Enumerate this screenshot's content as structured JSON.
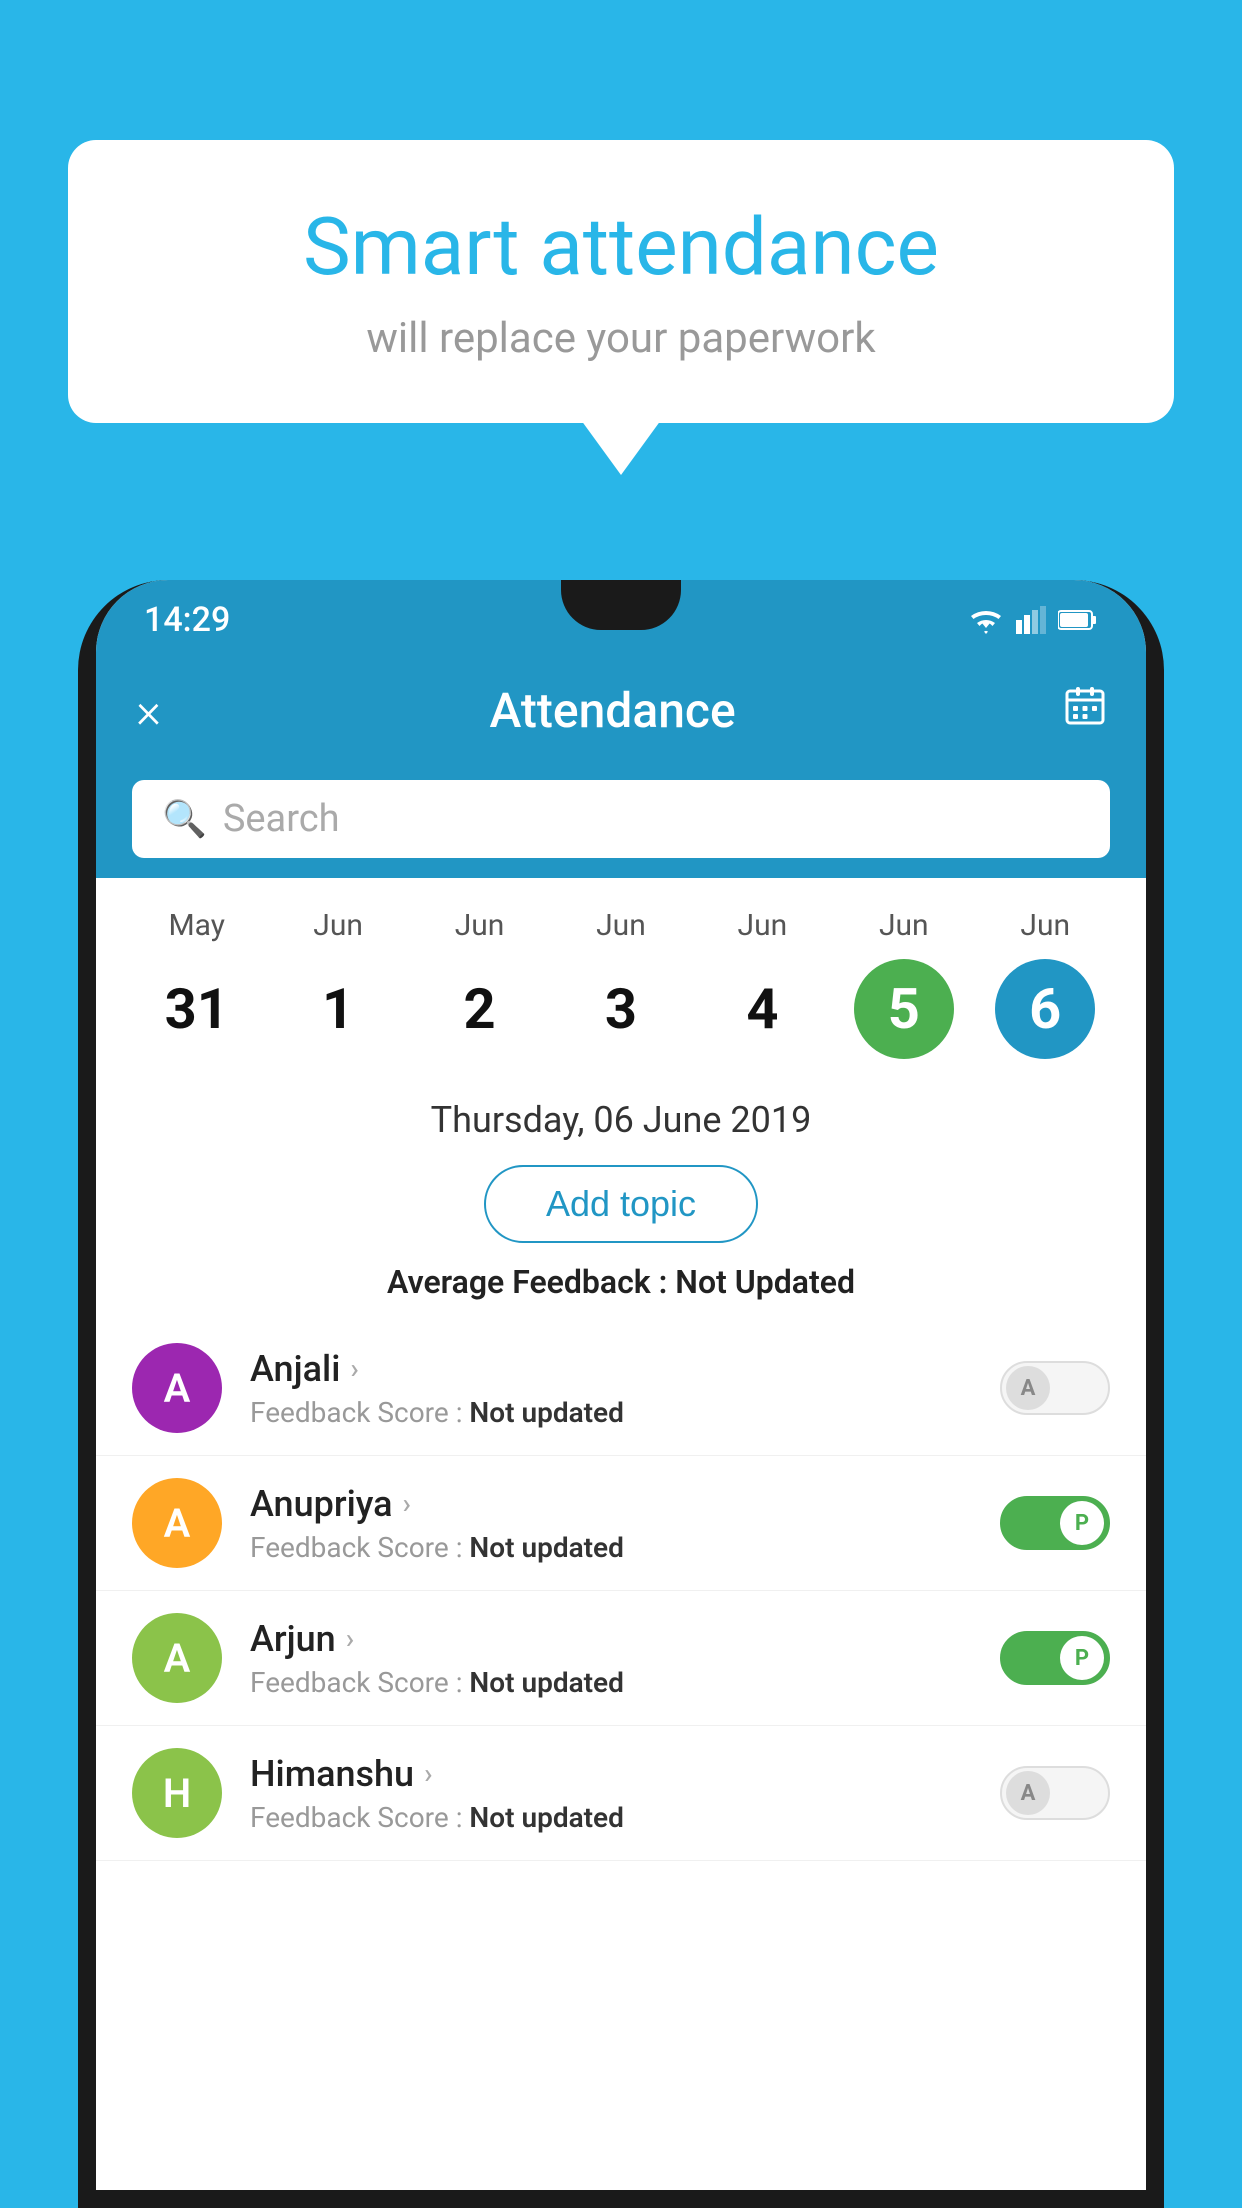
{
  "background_color": "#29B6E8",
  "speech_bubble": {
    "title": "Smart attendance",
    "subtitle": "will replace your paperwork"
  },
  "status_bar": {
    "time": "14:29"
  },
  "app_header": {
    "title": "Attendance",
    "close_label": "×",
    "calendar_icon": "calendar"
  },
  "search": {
    "placeholder": "Search"
  },
  "calendar": {
    "days": [
      {
        "month": "May",
        "date": "31",
        "active": false
      },
      {
        "month": "Jun",
        "date": "1",
        "active": false
      },
      {
        "month": "Jun",
        "date": "2",
        "active": false
      },
      {
        "month": "Jun",
        "date": "3",
        "active": false
      },
      {
        "month": "Jun",
        "date": "4",
        "active": false
      },
      {
        "month": "Jun",
        "date": "5",
        "active": "green"
      },
      {
        "month": "Jun",
        "date": "6",
        "active": "blue"
      }
    ]
  },
  "selected_date": "Thursday, 06 June 2019",
  "add_topic_label": "Add topic",
  "avg_feedback_label": "Average Feedback :",
  "avg_feedback_value": "Not Updated",
  "students": [
    {
      "name": "Anjali",
      "avatar_letter": "A",
      "avatar_color": "#9C27B0",
      "feedback_label": "Feedback Score :",
      "feedback_value": "Not updated",
      "toggle": "off",
      "toggle_letter": "A"
    },
    {
      "name": "Anupriya",
      "avatar_letter": "A",
      "avatar_color": "#FFA726",
      "feedback_label": "Feedback Score :",
      "feedback_value": "Not updated",
      "toggle": "on",
      "toggle_letter": "P"
    },
    {
      "name": "Arjun",
      "avatar_letter": "A",
      "avatar_color": "#8BC34A",
      "feedback_label": "Feedback Score :",
      "feedback_value": "Not updated",
      "toggle": "on",
      "toggle_letter": "P"
    },
    {
      "name": "Himanshu",
      "avatar_letter": "H",
      "avatar_color": "#8BC34A",
      "feedback_label": "Feedback Score :",
      "feedback_value": "Not updated",
      "toggle": "off",
      "toggle_letter": "A"
    }
  ]
}
